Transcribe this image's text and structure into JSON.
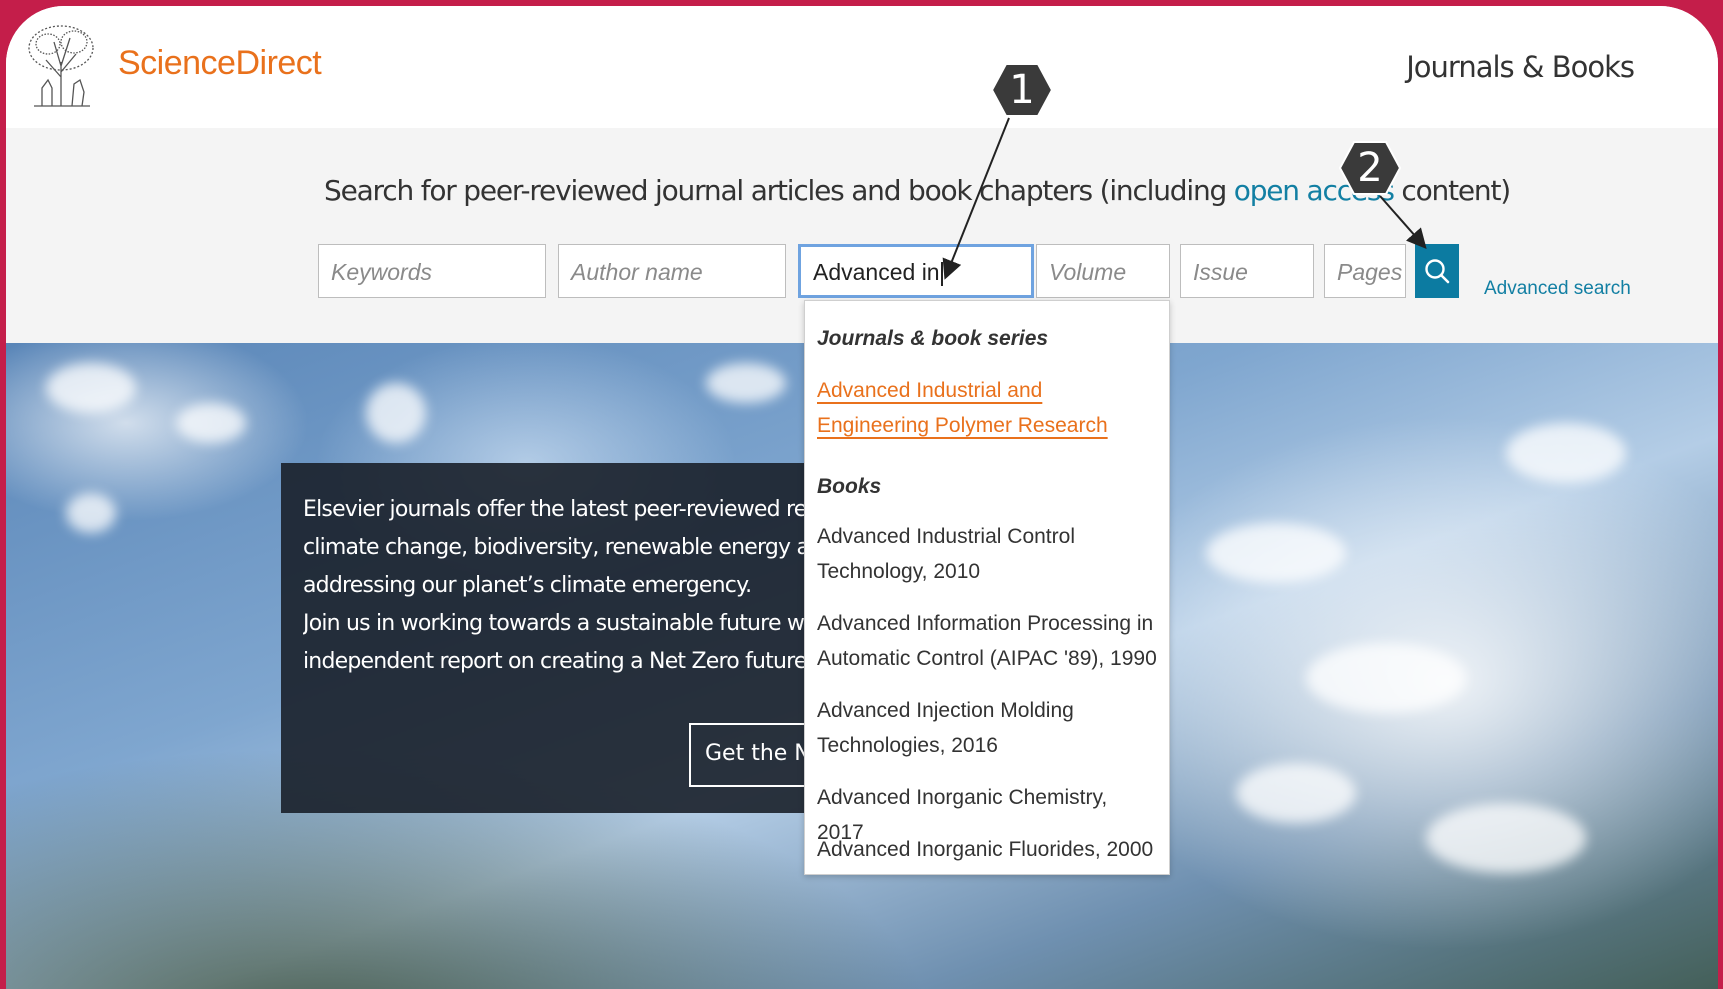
{
  "header": {
    "brand": "ScienceDirect",
    "nav_journals": "Journals & Books"
  },
  "search": {
    "tagline_pre": "Search for peer-reviewed journal articles and book chapters (including ",
    "tagline_link": "open access",
    "tagline_post": " content)",
    "keywords_placeholder": "Keywords",
    "author_placeholder": "Author name",
    "journal_value": "Advanced in",
    "volume_placeholder": "Volume",
    "issue_placeholder": "Issue",
    "pages_placeholder": "Pages",
    "advanced_link": "Advanced search"
  },
  "promo": {
    "line1": "Elsevier journals offer the latest peer-reviewed research papers on",
    "line2": "climate change, biodiversity, renewable energy and other topics",
    "line3": "addressing our planet’s climate emergency.",
    "line4": "Join us in working towards a sustainable future with our editor's",
    "line5": "independent report on creating a Net Zero future.",
    "button": "Get the Net Zero report"
  },
  "dropdown": {
    "journals_heading": "Journals & book series",
    "journal_items": [
      "Advanced Industrial and Engineering Polymer Research"
    ],
    "books_heading": "Books",
    "book_items": [
      "Advanced Industrial Control Technology, 2010",
      "Advanced Information Processing in Automatic Control (AIPAC '89), 1990",
      "Advanced Injection Molding Technologies, 2016",
      "Advanced Inorganic Chemistry, 2017",
      "Advanced Inorganic Fluorides, 2000"
    ]
  },
  "annotations": {
    "marker1": "1",
    "marker2": "2"
  },
  "colors": {
    "brand_orange": "#e9711c",
    "link_blue": "#127fa3",
    "search_button": "#0c7ba1",
    "frame_border": "#c41e4a"
  }
}
